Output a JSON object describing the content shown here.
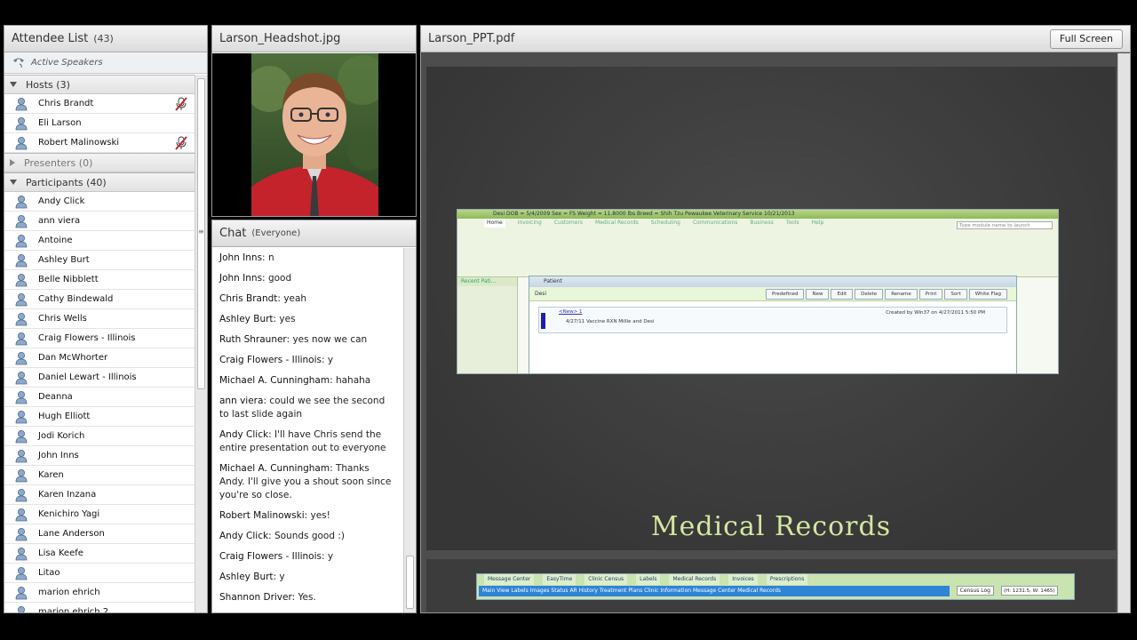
{
  "attendee_list": {
    "title": "Attendee List",
    "count": "(43)",
    "active_speakers": "Active Speakers",
    "hosts_label": "Hosts (3)",
    "hosts": [
      {
        "name": "Chris Brandt",
        "speaking": true
      },
      {
        "name": "Eli Larson",
        "speaking": false
      },
      {
        "name": "Robert Malinowski",
        "speaking": true
      }
    ],
    "presenters_label": "Presenters (0)",
    "participants_label": "Participants (40)",
    "participants": [
      "Andy Click",
      "ann viera",
      "Antoine",
      "Ashley Burt",
      "Belle Nibblett",
      "Cathy Bindewald",
      "Chris Wells",
      "Craig Flowers - Illinois",
      "Dan McWhorter",
      "Daniel Lewart - Illinois",
      "Deanna",
      "Hugh Elliott",
      "Jodi Korich",
      "John Inns",
      "Karen",
      "Karen Inzana",
      "Kenichiro Yagi",
      "Lane Anderson",
      "Lisa Keefe",
      "Litao",
      "marion ehrich",
      "marion ehrich 2"
    ]
  },
  "headshot": {
    "title": "Larson_Headshot.jpg"
  },
  "chat": {
    "title": "Chat",
    "scope": "(Everyone)",
    "messages": [
      {
        "who": "John Inns",
        "text": "n"
      },
      {
        "who": "John Inns",
        "text": "good"
      },
      {
        "who": "Chris Brandt",
        "text": "yeah"
      },
      {
        "who": "Ashley Burt",
        "text": "yes"
      },
      {
        "who": "Ruth Shrauner",
        "text": "yes now we can"
      },
      {
        "who": "Craig Flowers - Illinois",
        "text": "y"
      },
      {
        "who": "Michael A. Cunningham",
        "text": "hahaha"
      },
      {
        "who": "ann viera",
        "text": "could we see the second to last slide again"
      },
      {
        "who": "Andy Click",
        "text": "I'll have Chris send the entire presentation out to everyone"
      },
      {
        "who": "Michael A. Cunningham",
        "text": "Thanks Andy. I'll give you a shout soon since you're so close."
      },
      {
        "who": "Robert Malinowski",
        "text": "yes!"
      },
      {
        "who": "Andy Click",
        "text": "Sounds good :)"
      },
      {
        "who": "Craig Flowers - Illinois",
        "text": "y"
      },
      {
        "who": "Ashley Burt",
        "text": "y"
      },
      {
        "who": "Shannon Driver",
        "text": "Yes."
      }
    ]
  },
  "ppt": {
    "title": "Larson_PPT.pdf",
    "full_screen": "Full Screen",
    "slide_title": "Medical Records",
    "embedded": {
      "titlebar": "Desi   DOB = 5/4/2009   Sex = FS   Weight = 11.8000 lbs   Breed = Shih Tzu   Pewaukee Veterinary Service   10/21/2013",
      "tabs": [
        "Home",
        "Invoicing",
        "Customers",
        "Medical Records",
        "Scheduling",
        "Communications",
        "Business",
        "Tools",
        "Help"
      ],
      "search_placeholder": "Type module name to launch",
      "recent": "Recent Pati...",
      "dialog_title": "Patient",
      "dialog_name": "Desi",
      "dialog_buttons": [
        "Predefined",
        "New",
        "Edit",
        "Delete",
        "Rename",
        "Print",
        "Sort",
        "White Flag"
      ],
      "note_link": "<New> 1",
      "note_text": "4/27/11 Vaccine RXN Millie and Desi",
      "note_created": "Created by Win37 on 4/27/2011 5:50 PM"
    },
    "nav2": {
      "tabs": [
        "Message Center",
        "EasyTime",
        "Clinic Census",
        "Labels",
        "Medical Records",
        "Invoices",
        "Prescriptions"
      ],
      "bluebar": "Main View   Labels   Images   Status   AR History   Treatment Plans   Clinic Information   Message Center   Medical Records",
      "census_log": "Census Log",
      "coords": "(H: 1231.5, W: 1465)"
    }
  },
  "colors": {
    "slide_bg": "#3c3c3c",
    "slide_title": "#d4e6a0",
    "mic_red": "#c0262c"
  }
}
